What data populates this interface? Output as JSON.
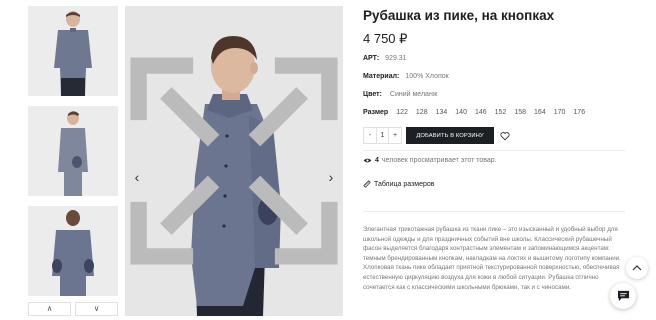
{
  "product": {
    "title": "Рубашка из пике, на кнопках",
    "price": "4 750 ₽",
    "article_label": "АРТ:",
    "article_value": "929.31",
    "material_label": "Материал:",
    "material_value": "100% Хлопок",
    "color_label": "Цвет:",
    "color_value": "Синий меланж",
    "size_label": "Размер",
    "sizes": [
      "122",
      "128",
      "134",
      "140",
      "146",
      "152",
      "158",
      "164",
      "170",
      "176"
    ]
  },
  "purchase": {
    "minus": "-",
    "quantity": "1",
    "plus": "+",
    "add_to_cart": "ДОБАВИТЬ В КОРЗИНУ"
  },
  "viewers": {
    "count": "4",
    "text": "человек просматривает этот товар."
  },
  "size_table_link": "Таблица размеров",
  "description": "Элегантная трикотажная рубашка из ткани пике – это изысканный и удобный выбор для школьной одежды и для праздничных событий вне школы. Классический рубашечный фасон выделяется благодаря контрастным элементам и запоминающимся акцентам: темным брендированным кнопкам, накладкам на локтях и вышитому логотипу компании. Хлопковая ткань пике обладает приятной текстурированной поверхностью, обеспечивая естественную циркуляцию воздуха для кожи в любой ситуации. Рубашка отлично сочетается как с классическими школьными брюками, так и с чиносами.",
  "gallery": {
    "prev_arrow": "‹",
    "next_arrow": "›",
    "thumb_up": "∧",
    "thumb_down": "∨"
  },
  "icons": [
    "chevron-left-icon",
    "chevron-right-icon",
    "fullscreen-icon",
    "heart-icon",
    "eye-icon",
    "ruler-icon",
    "chevron-up-icon",
    "chat-icon"
  ],
  "colors": {
    "accent": "#1c1f24",
    "shirt": "#6b7590",
    "background": "#e8e8e8"
  }
}
